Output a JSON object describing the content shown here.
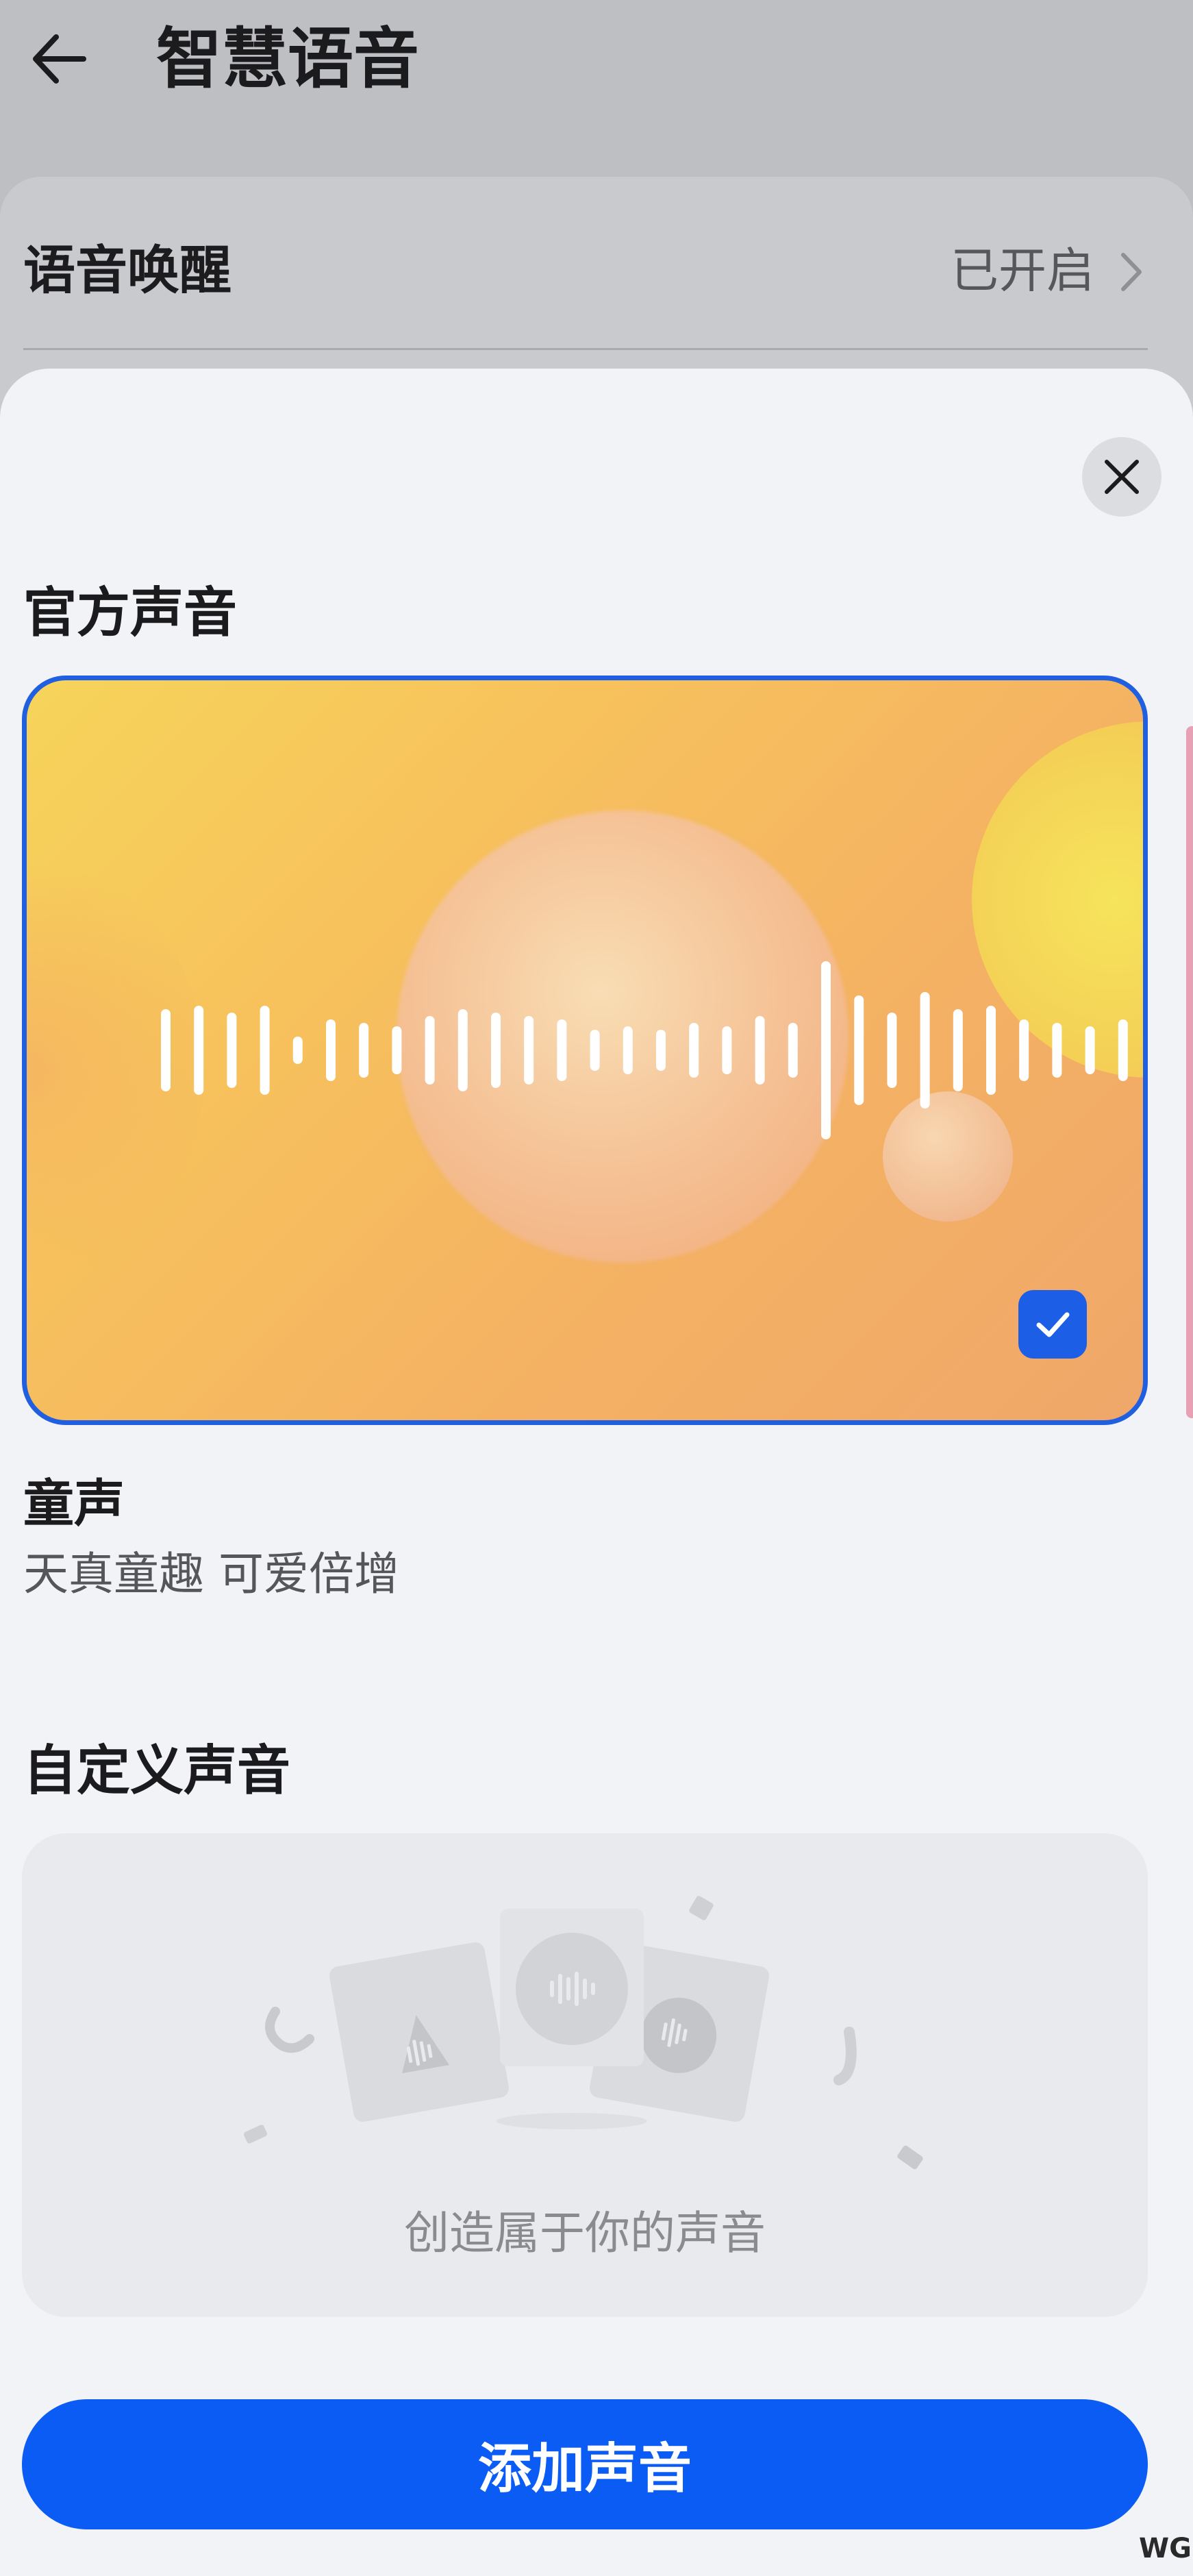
{
  "header": {
    "title": "智慧语音",
    "back_icon": "arrow-left-icon"
  },
  "settings_row": {
    "label": "语音唤醒",
    "value": "已开启",
    "chevron_icon": "chevron-right-icon"
  },
  "sheet": {
    "close_icon": "close-icon",
    "official_section_title": "官方声音",
    "selected_voice": {
      "name": "童声",
      "description": "天真童趣 可爱倍增",
      "selected": true,
      "card_colors": [
        "#f6d45a",
        "#f7c25c",
        "#f4b163",
        "#f0a76a"
      ],
      "check_icon": "checkmark-icon",
      "wave_icon": "sound-wave-icon"
    },
    "custom_section_title": "自定义声音",
    "custom_placeholder": "创造属于你的声音",
    "add_button_label": "添加声音"
  },
  "watermark": "WG",
  "colors": {
    "accent": "#0b5cf5",
    "selected_border": "#1f5fe0",
    "sheet_background": "#f2f3f6"
  }
}
